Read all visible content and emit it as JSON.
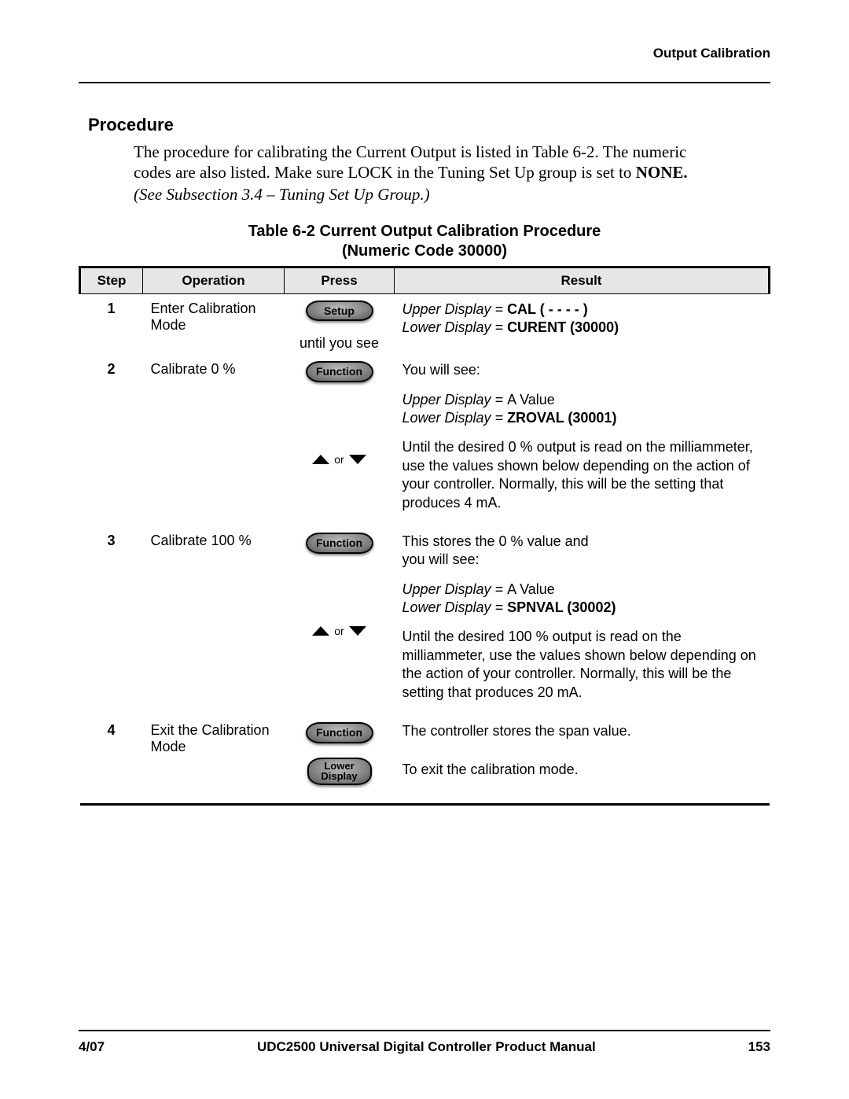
{
  "header": {
    "section_label": "Output Calibration"
  },
  "section": {
    "heading": "Procedure",
    "intro_line1": "The procedure for calibrating the Current Output is listed in Table 6-2. The numeric",
    "intro_line2_prefix": "codes are also listed. Make sure LOCK in the Tuning Set Up group is set to ",
    "intro_line2_bold": "NONE.",
    "intro_ref": "(See Subsection 3.4 – Tuning Set Up Group.)"
  },
  "table": {
    "caption_line1": "Table 6-2  Current Output Calibration Procedure",
    "caption_line2": "(Numeric Code 30000)",
    "headers": {
      "step": "Step",
      "operation": "Operation",
      "press": "Press",
      "result": "Result"
    }
  },
  "keys": {
    "setup": "Setup",
    "function": "Function",
    "lower_display_line1": "Lower",
    "lower_display_line2": "Display",
    "or_label": "or"
  },
  "steps": {
    "s1": {
      "num": "1",
      "operation": "Enter Calibration Mode",
      "press_note": "until you see",
      "result_upper_label": "Upper Display = ",
      "result_upper_value": "CAL ( - - - - )",
      "result_lower_label": "Lower Display = ",
      "result_lower_value": "CURENT (30000)"
    },
    "s2": {
      "num": "2",
      "operation": "Calibrate 0 %",
      "result_intro": "You will see:",
      "result_upper_label": "Upper Display = ",
      "result_upper_value": "A Value",
      "result_lower_label": "Lower Display = ",
      "result_lower_value": "ZROVAL (30001)",
      "result_arrows": "Until the desired 0 % output is read on the milliammeter, use the values shown below depending on the action of your controller.  Normally, this will be the setting that produces 4 mA."
    },
    "s3": {
      "num": "3",
      "operation": "Calibrate 100 %",
      "result_intro_l1": "This stores the 0 % value and",
      "result_intro_l2": "you will see:",
      "result_upper_label": "Upper Display = ",
      "result_upper_value": "A Value",
      "result_lower_label": "Lower Display = ",
      "result_lower_value": "SPNVAL (30002)",
      "result_arrows": "Until the desired 100 % output is read on the milliammeter, use the values shown below depending on the action of your controller.  Normally, this will be the setting that produces 20 mA."
    },
    "s4": {
      "num": "4",
      "operation": "Exit the Calibration Mode",
      "result_function": "The controller stores the span value.",
      "result_lower": "To exit the calibration mode."
    }
  },
  "footer": {
    "date": "4/07",
    "title": "UDC2500 Universal Digital Controller Product Manual",
    "page": "153"
  }
}
